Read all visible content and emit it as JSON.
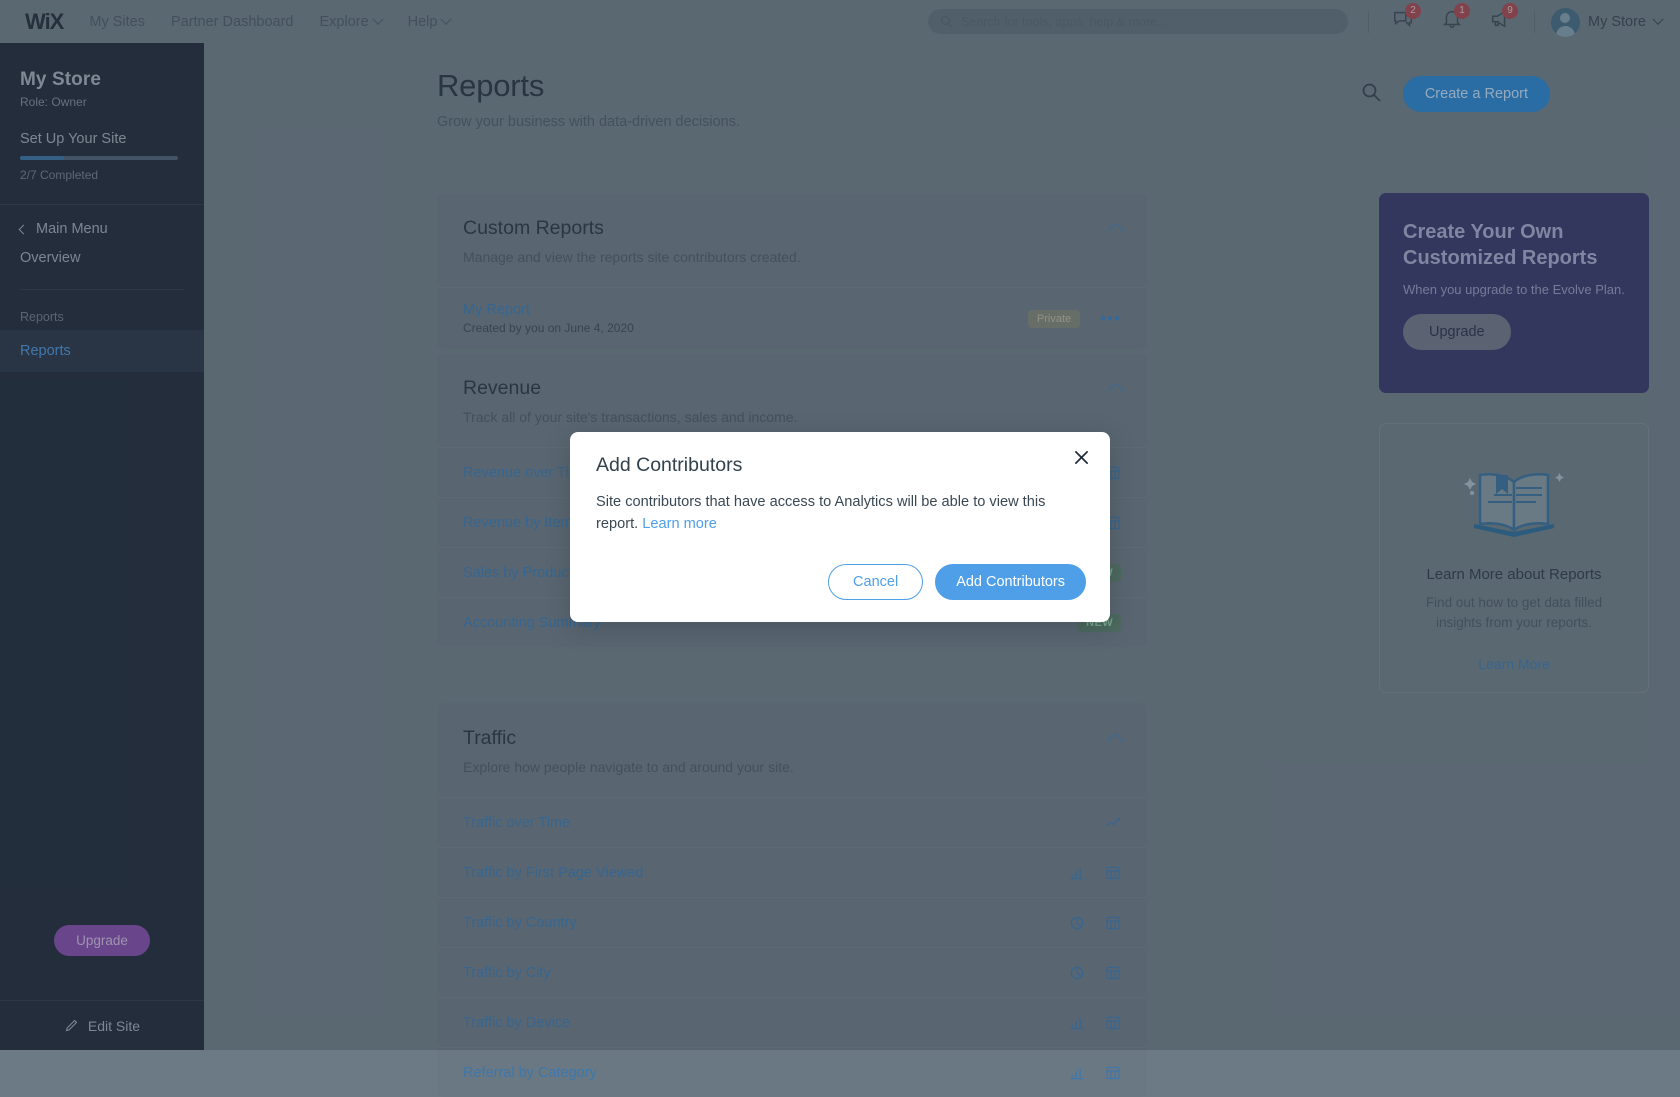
{
  "topbar": {
    "logo": "WiX",
    "nav": [
      {
        "label": "My Sites",
        "caret": false
      },
      {
        "label": "Partner Dashboard",
        "caret": false
      },
      {
        "label": "Explore",
        "caret": true
      },
      {
        "label": "Help",
        "caret": true
      }
    ],
    "search_placeholder": "Search for tools, apps, help & more...",
    "icons": [
      {
        "name": "chat-icon",
        "badge": "2"
      },
      {
        "name": "bell-icon",
        "badge": "1"
      },
      {
        "name": "megaphone-icon",
        "badge": "9"
      }
    ],
    "user_name": "My Store"
  },
  "sidebar": {
    "store_name": "My Store",
    "role": "Role: Owner",
    "setup_label": "Set Up Your Site",
    "setup_progress_text": "2/7 Completed",
    "setup_progress_percent": 28,
    "main_menu": "Main Menu",
    "overview": "Overview",
    "group_label": "Reports",
    "active_item": "Reports",
    "upgrade": "Upgrade",
    "edit_site": "Edit Site"
  },
  "page": {
    "title": "Reports",
    "subtitle": "Grow your business with data-driven decisions.",
    "create_button": "Create a Report"
  },
  "sections": [
    {
      "id": "custom-reports",
      "title": "Custom Reports",
      "description": "Manage and view the reports site contributors created.",
      "rows": [
        {
          "label": "My Report",
          "sub": "Created by you on June 4, 2020",
          "badge": "Private",
          "badge_kind": "private",
          "icons": [
            "more-icon"
          ]
        }
      ]
    },
    {
      "id": "revenue",
      "title": "Revenue",
      "description": "Track all of your site's transactions, sales and income.",
      "rows": [
        {
          "label": "Revenue over Time",
          "sub": "",
          "badge": "",
          "badge_kind": "",
          "icons": [
            "table-icon"
          ]
        },
        {
          "label": "Revenue by Item",
          "sub": "",
          "badge": "",
          "badge_kind": "",
          "icons": [
            "table-icon"
          ]
        },
        {
          "label": "Sales by Product",
          "sub": "",
          "badge": "NEW",
          "badge_kind": "new",
          "icons": []
        },
        {
          "label": "Accounting Summary",
          "sub": "",
          "badge": "NEW",
          "badge_kind": "new",
          "icons": []
        }
      ]
    },
    {
      "id": "traffic",
      "title": "Traffic",
      "description": "Explore how people navigate to and around your site.",
      "rows": [
        {
          "label": "Traffic over Time",
          "sub": "",
          "badge": "",
          "badge_kind": "",
          "icons": [
            "line-chart-icon"
          ]
        },
        {
          "label": "Traffic by First Page Viewed",
          "sub": "",
          "badge": "",
          "badge_kind": "",
          "icons": [
            "bar-chart-icon",
            "table-icon"
          ]
        },
        {
          "label": "Traffic by Country",
          "sub": "",
          "badge": "",
          "badge_kind": "",
          "icons": [
            "pie-chart-icon",
            "table-icon"
          ]
        },
        {
          "label": "Traffic by City",
          "sub": "",
          "badge": "",
          "badge_kind": "",
          "icons": [
            "pie-chart-icon",
            "table-icon"
          ]
        },
        {
          "label": "Traffic by Device",
          "sub": "",
          "badge": "",
          "badge_kind": "",
          "icons": [
            "bar-chart-icon",
            "table-icon"
          ]
        },
        {
          "label": "Referral by Category",
          "sub": "",
          "badge": "",
          "badge_kind": "",
          "icons": [
            "bar-chart-icon",
            "table-icon"
          ]
        }
      ]
    }
  ],
  "promo": {
    "title": "Create Your Own Customized Reports",
    "text": "When you upgrade to the Evolve Plan.",
    "button": "Upgrade"
  },
  "learn": {
    "title": "Learn More about Reports",
    "text": "Find out how to get data filled insights from your reports.",
    "link": "Learn More"
  },
  "modal": {
    "title": "Add Contributors",
    "body_text": "Site contributors that have access to Analytics will be able to view this report. ",
    "link_text": "Learn more",
    "cancel": "Cancel",
    "confirm": "Add Contributors"
  },
  "colors": {
    "accent_blue": "#4f9fe8",
    "link_blue": "#3d77ab",
    "sidebar_bg": "#242f3f",
    "promo_bg": "#393b6b",
    "badge_red": "#9e4a52"
  }
}
